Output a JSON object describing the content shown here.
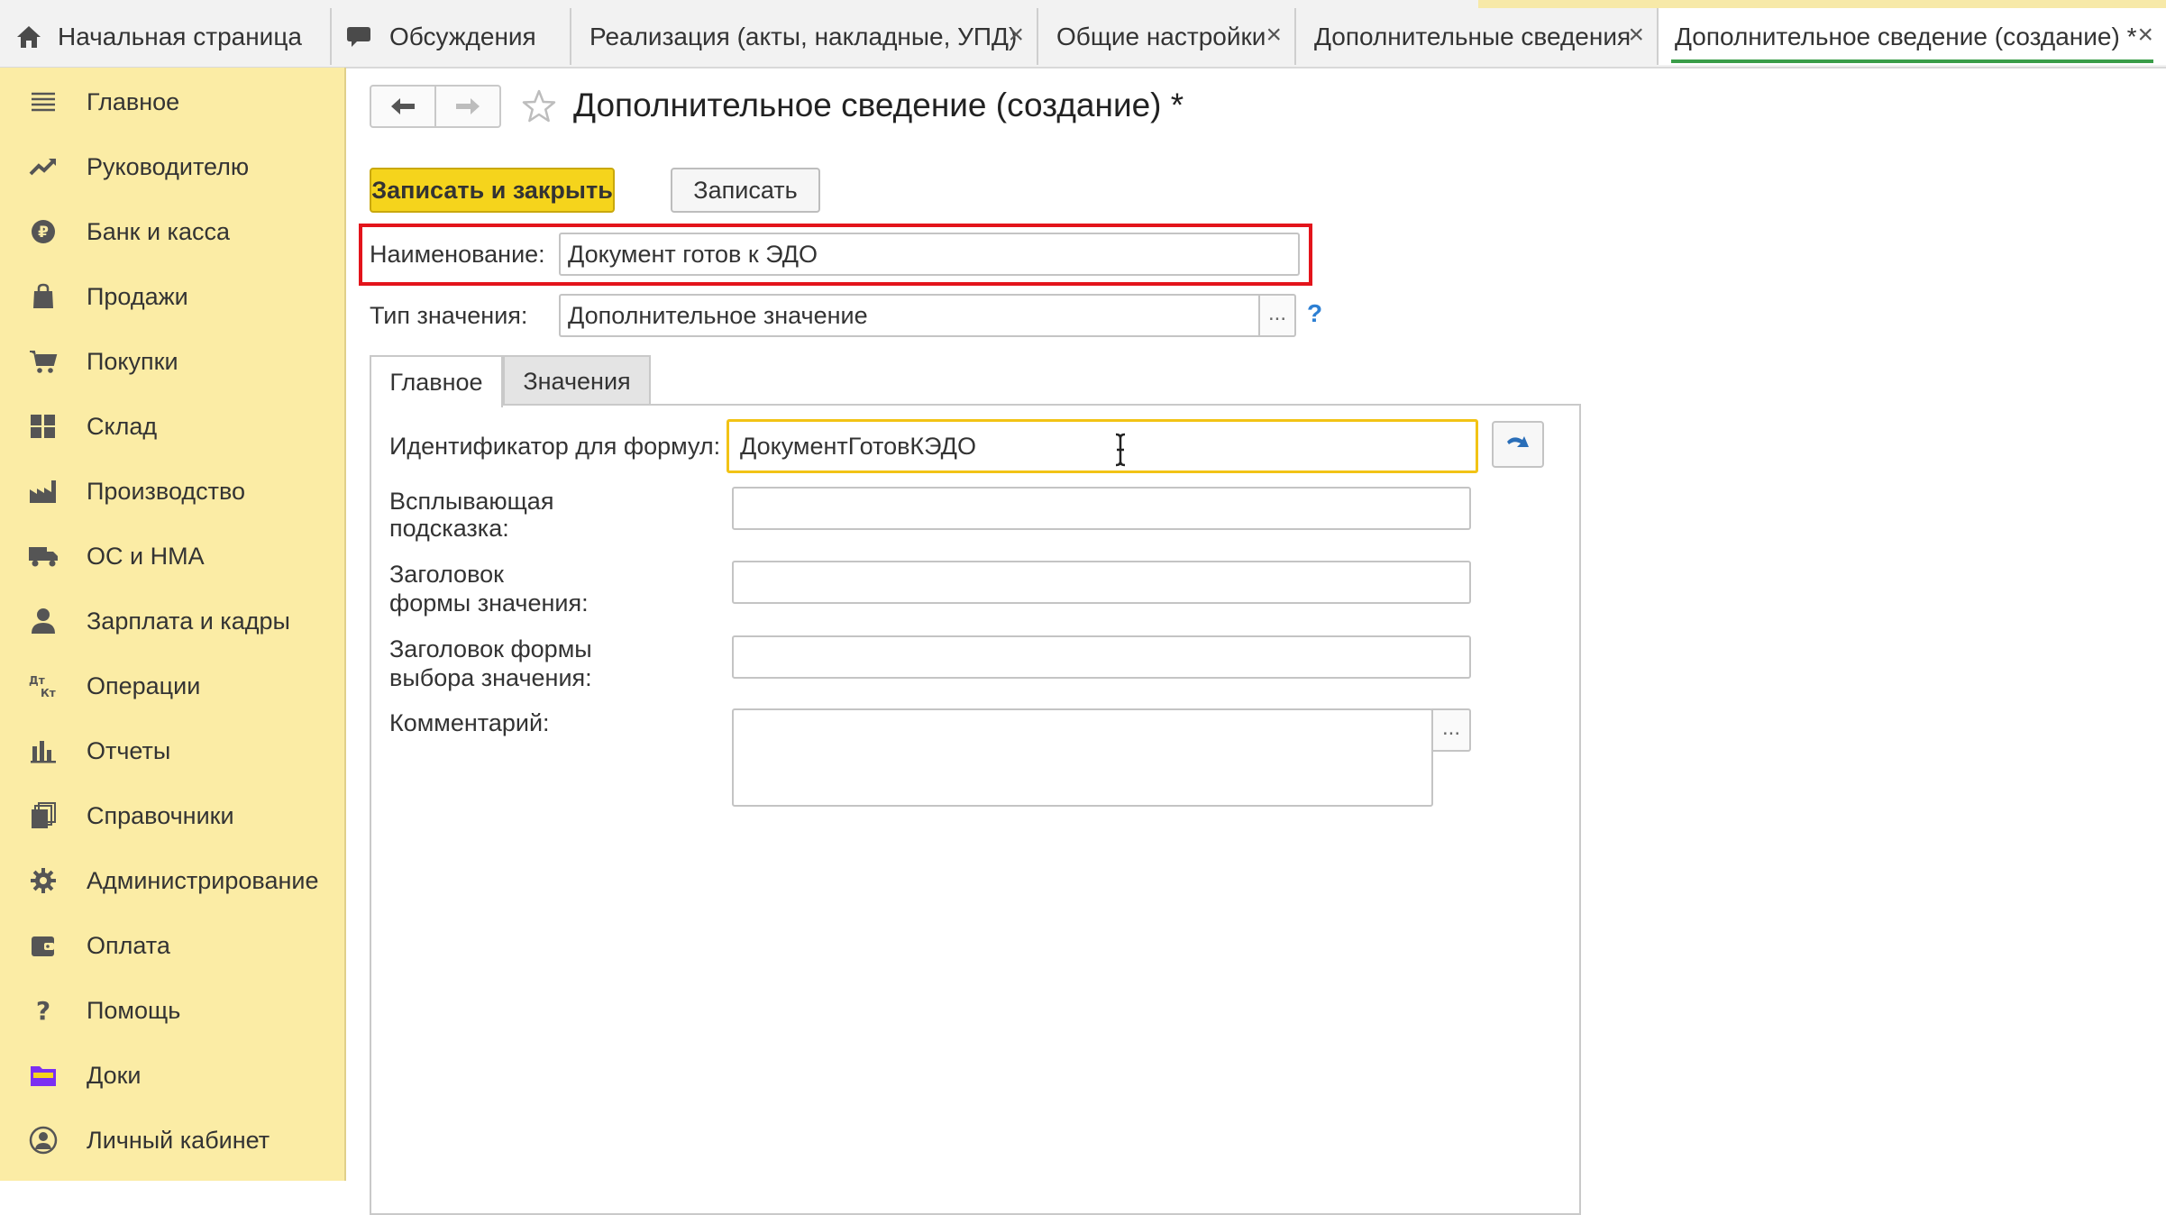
{
  "tabs": [
    {
      "label": "Начальная страница",
      "icon": "home-icon",
      "closable": false
    },
    {
      "label": "Обсуждения",
      "icon": "chat-icon",
      "closable": false
    },
    {
      "label": "Реализация (акты, накладные, УПД)",
      "closable": true
    },
    {
      "label": "Общие настройки",
      "closable": true
    },
    {
      "label": "Дополнительные сведения",
      "closable": true
    },
    {
      "label": "Дополнительное сведение (создание) *",
      "closable": true,
      "active": true
    }
  ],
  "tab_close_glyph": "×",
  "sidebar": {
    "items": [
      {
        "label": "Главное",
        "icon": "menu-lines-icon"
      },
      {
        "label": "Руководителю",
        "icon": "trend-up-icon"
      },
      {
        "label": "Банк и касса",
        "icon": "ruble-coin-icon"
      },
      {
        "label": "Продажи",
        "icon": "shopping-bag-icon"
      },
      {
        "label": "Покупки",
        "icon": "cart-icon"
      },
      {
        "label": "Склад",
        "icon": "warehouse-grid-icon"
      },
      {
        "label": "Производство",
        "icon": "factory-icon"
      },
      {
        "label": "ОС и НМА",
        "icon": "truck-icon"
      },
      {
        "label": "Зарплата и кадры",
        "icon": "person-icon"
      },
      {
        "label": "Операции",
        "icon": "dt-kt-icon"
      },
      {
        "label": "Отчеты",
        "icon": "bar-chart-icon"
      },
      {
        "label": "Справочники",
        "icon": "books-icon"
      },
      {
        "label": "Администрирование",
        "icon": "gear-icon"
      },
      {
        "label": "Оплата",
        "icon": "wallet-icon"
      },
      {
        "label": "Помощь",
        "icon": "question-icon"
      },
      {
        "label": "Доки",
        "icon": "folder-icon"
      },
      {
        "label": "Личный кабинет",
        "icon": "user-circle-icon"
      }
    ]
  },
  "form": {
    "title": "Дополнительное сведение (создание) *",
    "save_close_label": "Записать и закрыть",
    "save_label": "Записать",
    "name_label": "Наименование:",
    "name_value": "Документ готов к ЭДО",
    "type_label": "Тип значения:",
    "type_value": "Дополнительное значение",
    "dots": "...",
    "help": "?",
    "inner_tabs": [
      "Главное",
      "Значения"
    ],
    "fields": {
      "id_label": "Идентификатор для формул:",
      "id_value": "ДокументГотовКЭДО",
      "tooltip_label_1": "Всплывающая",
      "tooltip_label_2": "подсказка:",
      "value_form_title_label_1": "Заголовок",
      "value_form_title_label_2": "формы значения:",
      "choice_form_title_label_1": "Заголовок формы",
      "choice_form_title_label_2": "выбора значения:",
      "comment_label": "Комментарий:"
    }
  },
  "colors": {
    "sidebar_bg": "#fbeca5",
    "primary_button": "#f5d41c",
    "active_tab_underline": "#3a9d49",
    "highlight_border": "#e3141b",
    "focus_border": "#f2c315"
  }
}
